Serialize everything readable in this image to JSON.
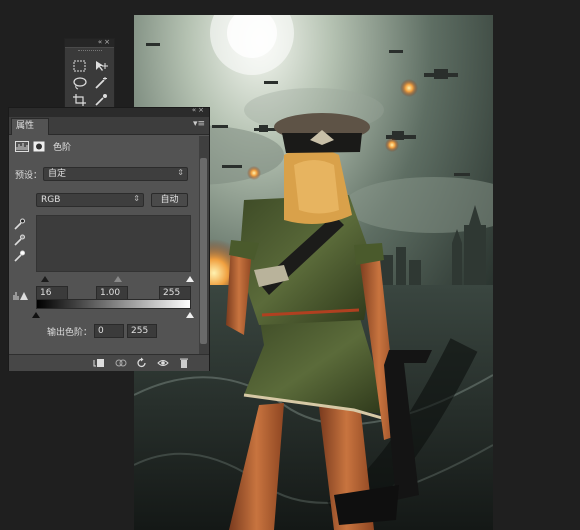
{
  "properties_panel": {
    "tab_label": "属性",
    "adjustment_title": "色阶",
    "preset_label": "预设：",
    "preset_value": "自定",
    "channel_value": "RGB",
    "auto_label": "自动",
    "input_black": "16",
    "input_gamma": "1.00",
    "input_white": "255",
    "output_label": "输出色阶：",
    "output_black": "0",
    "output_white": "255"
  },
  "icons": {
    "tools": [
      "marquee-icon",
      "move-icon",
      "lasso-icon",
      "magic-wand-icon",
      "crop-icon",
      "eyedropper-icon"
    ],
    "footer": [
      "clip-to-layer-icon",
      "view-previous-icon",
      "reset-icon",
      "visibility-eye-icon",
      "trash-icon"
    ]
  },
  "colors": {
    "panel_bg": "#535353",
    "canvas_bg": "#1f1f1f"
  }
}
